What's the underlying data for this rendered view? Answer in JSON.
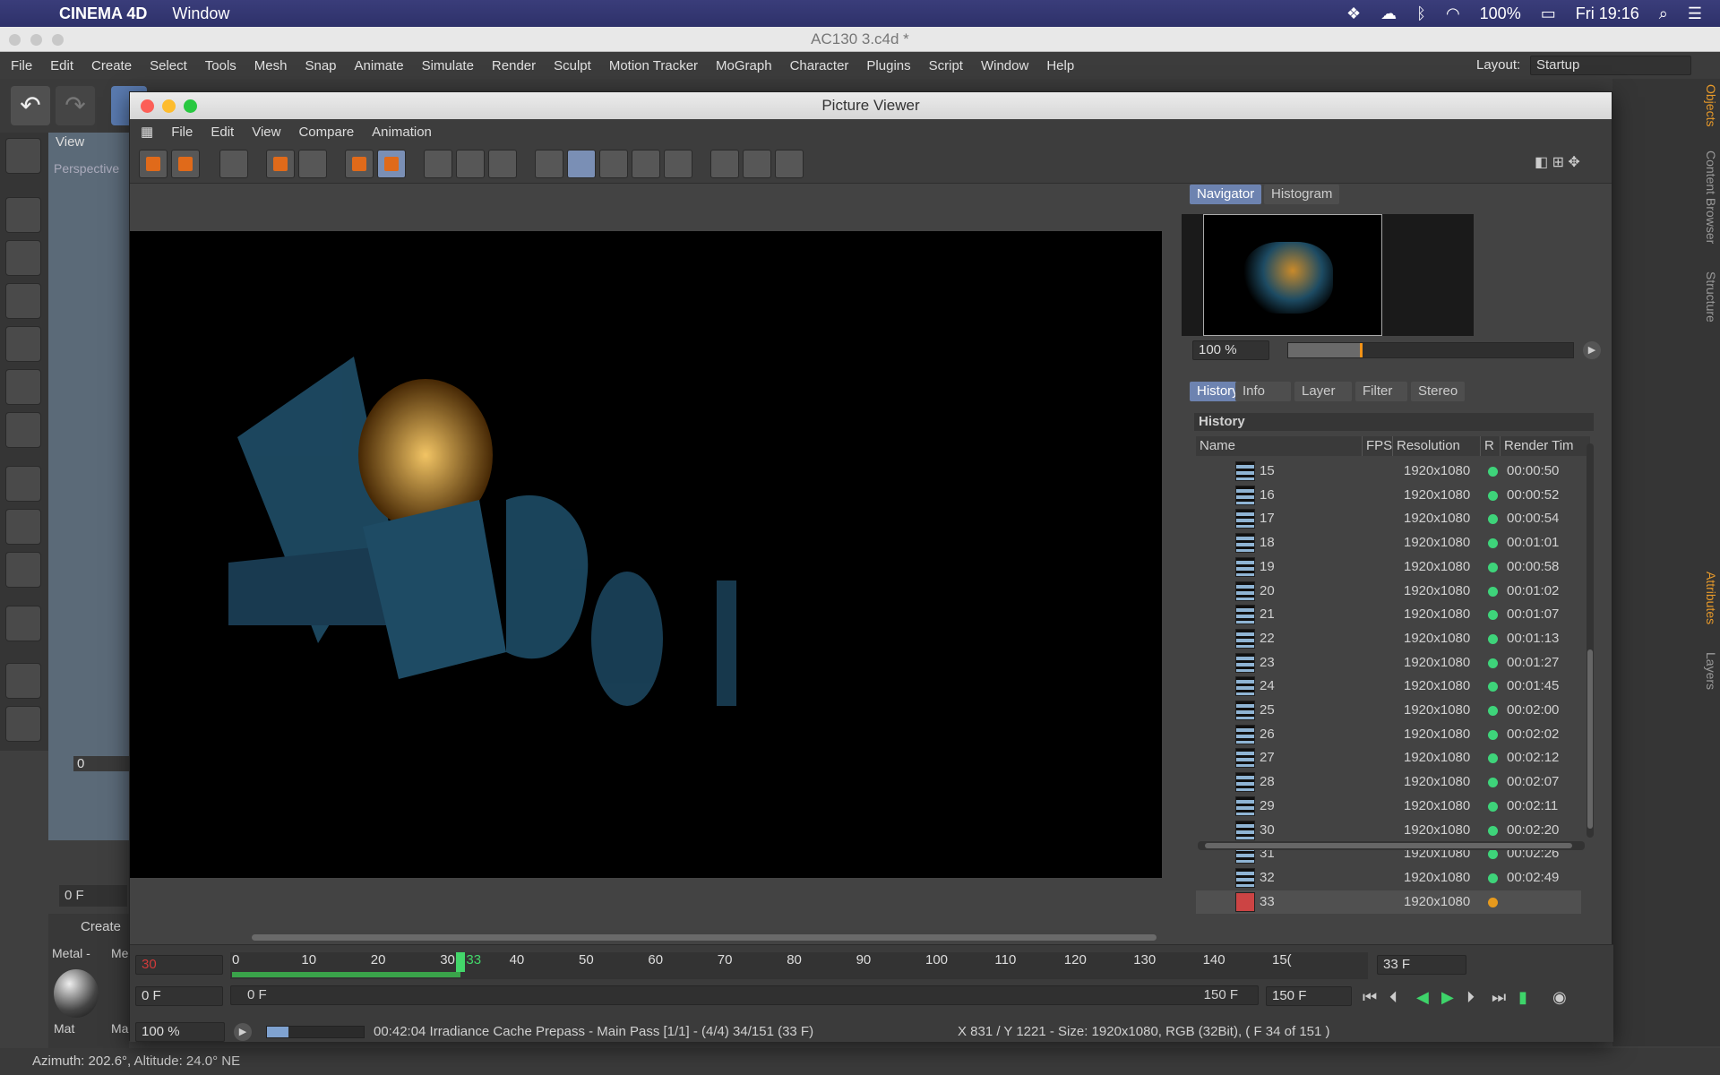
{
  "macos_menubar": {
    "app_name": "CINEMA 4D",
    "menu_window": "Window",
    "battery": "100%",
    "clock": "Fri 19:16"
  },
  "document_title": "AC130 3.c4d *",
  "c4d_menu": [
    "File",
    "Edit",
    "Create",
    "Select",
    "Tools",
    "Mesh",
    "Snap",
    "Animate",
    "Simulate",
    "Render",
    "Sculpt",
    "Motion Tracker",
    "MoGraph",
    "Character",
    "Plugins",
    "Script",
    "Window",
    "Help"
  ],
  "layout": {
    "label": "Layout:",
    "value": "Startup"
  },
  "viewport": {
    "menu_label": "View",
    "camera_label": "Perspective",
    "frame_field": "0 F",
    "frame_num": "0"
  },
  "material_manager": {
    "header": "Create",
    "tab1": "Metal -",
    "tab2": "Me",
    "mat1": "Mat",
    "mat2": "Ma"
  },
  "right_dock_tabs": [
    "Objects",
    "Content Browser",
    "Structure",
    "Attributes",
    "Layers"
  ],
  "statusbar_text": "Azimuth: 202.6°, Altitude: 24.0°  NE",
  "picture_viewer": {
    "title": "Picture Viewer",
    "menu": [
      "File",
      "Edit",
      "View",
      "Compare",
      "Animation"
    ],
    "top_tabs": [
      {
        "label": "Navigator",
        "active": true
      },
      {
        "label": "Histogram",
        "active": false
      }
    ],
    "zoom_field": "100 %",
    "zoom_slider_fraction": 0.25,
    "panel_tabs": [
      {
        "label": "History",
        "active": true
      },
      {
        "label": "Info",
        "active": false
      },
      {
        "label": "Layer",
        "active": false
      },
      {
        "label": "Filter",
        "active": false
      },
      {
        "label": "Stereo",
        "active": false
      }
    ],
    "history_header": "History",
    "history_columns": [
      "Name",
      "FPS",
      "Resolution",
      "R",
      "Render Tim"
    ],
    "history_rows": [
      {
        "name": "15",
        "res": "1920x1080",
        "time": "00:00:50"
      },
      {
        "name": "16",
        "res": "1920x1080",
        "time": "00:00:52"
      },
      {
        "name": "17",
        "res": "1920x1080",
        "time": "00:00:54"
      },
      {
        "name": "18",
        "res": "1920x1080",
        "time": "00:01:01"
      },
      {
        "name": "19",
        "res": "1920x1080",
        "time": "00:00:58"
      },
      {
        "name": "20",
        "res": "1920x1080",
        "time": "00:01:02"
      },
      {
        "name": "21",
        "res": "1920x1080",
        "time": "00:01:07"
      },
      {
        "name": "22",
        "res": "1920x1080",
        "time": "00:01:13"
      },
      {
        "name": "23",
        "res": "1920x1080",
        "time": "00:01:27"
      },
      {
        "name": "24",
        "res": "1920x1080",
        "time": "00:01:45"
      },
      {
        "name": "25",
        "res": "1920x1080",
        "time": "00:02:00"
      },
      {
        "name": "26",
        "res": "1920x1080",
        "time": "00:02:02"
      },
      {
        "name": "27",
        "res": "1920x1080",
        "time": "00:02:12"
      },
      {
        "name": "28",
        "res": "1920x1080",
        "time": "00:02:07"
      },
      {
        "name": "29",
        "res": "1920x1080",
        "time": "00:02:11"
      },
      {
        "name": "30",
        "res": "1920x1080",
        "time": "00:02:20"
      },
      {
        "name": "31",
        "res": "1920x1080",
        "time": "00:02:26"
      },
      {
        "name": "32",
        "res": "1920x1080",
        "time": "00:02:49"
      },
      {
        "name": "33",
        "res": "1920x1080",
        "time": ""
      }
    ],
    "timeline": {
      "start_field": "30",
      "current_field": "0 F",
      "end_field": "33 F",
      "ruler_ticks": [
        "0",
        "10",
        "20",
        "30",
        "33",
        "40",
        "50",
        "60",
        "70",
        "80",
        "90",
        "100",
        "110",
        "120",
        "130",
        "140",
        "15("
      ],
      "range_start": "0 F",
      "range_end": "150 F",
      "end_frame_field": "150 F"
    },
    "status": {
      "zoom": "100 %",
      "progress_fraction": 0.22,
      "render_message": "00:42:04 Irradiance Cache Prepass - Main Pass [1/1] - (4/4) 34/151 (33 F)",
      "image_info": "X 831 / Y 1221 - Size: 1920x1080, RGB (32Bit),  ( F 34 of 151 )"
    }
  }
}
